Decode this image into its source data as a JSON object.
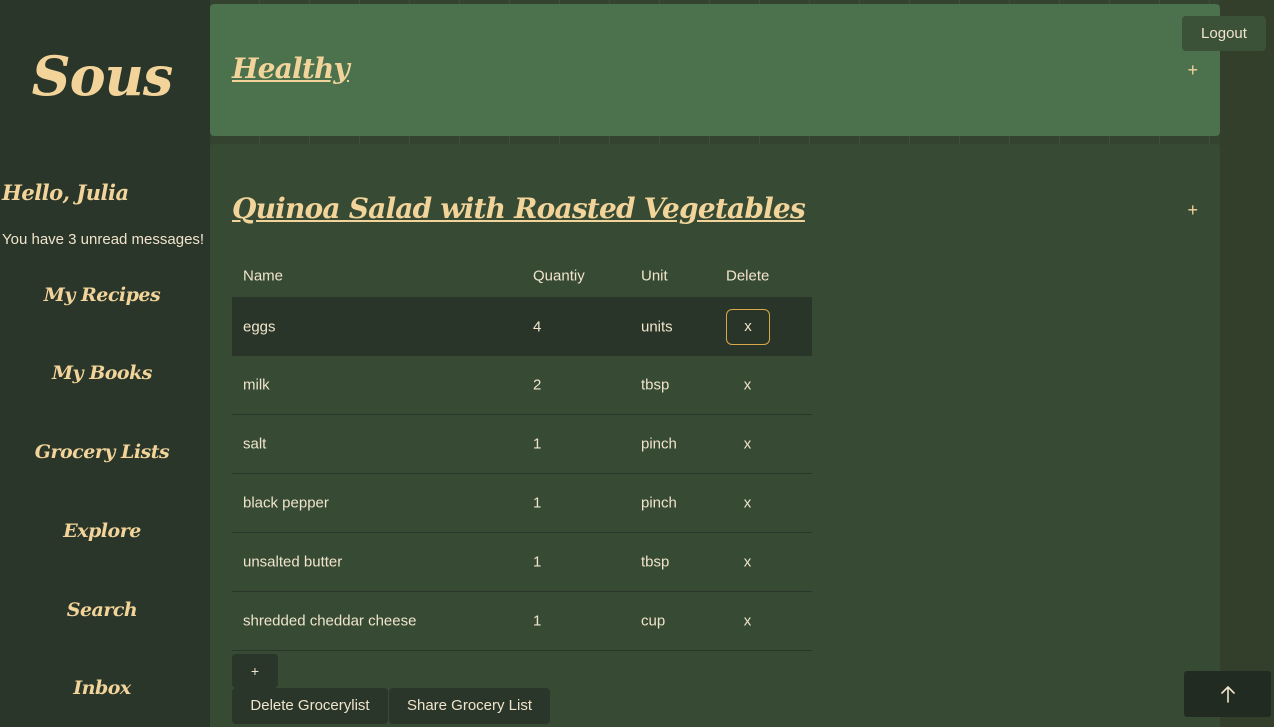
{
  "sidebar": {
    "logo": "Sous",
    "greeting": "Hello, Julia",
    "unread": "You have 3 unread messages!",
    "nav": [
      "My Recipes",
      "My Books",
      "Grocery Lists",
      "Explore",
      "Search",
      "Inbox"
    ]
  },
  "header": {
    "logout_label": "Logout"
  },
  "lists": [
    {
      "title": "Healthy",
      "expand_label": "+"
    },
    {
      "title": "Quinoa Salad with Roasted Vegetables",
      "expand_label": "+",
      "columns": [
        "Name",
        "Quantiy",
        "Unit",
        "Delete"
      ],
      "items": [
        {
          "name": "eggs",
          "quantity": "4",
          "unit": "units",
          "delete": "x"
        },
        {
          "name": "milk",
          "quantity": "2",
          "unit": "tbsp",
          "delete": "x"
        },
        {
          "name": "salt",
          "quantity": "1",
          "unit": "pinch",
          "delete": "x"
        },
        {
          "name": "black pepper",
          "quantity": "1",
          "unit": "pinch",
          "delete": "x"
        },
        {
          "name": "unsalted butter",
          "quantity": "1",
          "unit": "tbsp",
          "delete": "x"
        },
        {
          "name": "shredded cheddar cheese",
          "quantity": "1",
          "unit": "cup",
          "delete": "x"
        }
      ],
      "add_item_label": "+",
      "delete_list_label": "Delete Grocerylist",
      "share_list_label": "Share Grocery List"
    }
  ],
  "icons": {
    "scroll_top": "arrow-up-icon"
  },
  "colors": {
    "accent": "#f2d49b",
    "highlight_border": "#d9a84a",
    "healthy_panel": "#4b714d"
  }
}
